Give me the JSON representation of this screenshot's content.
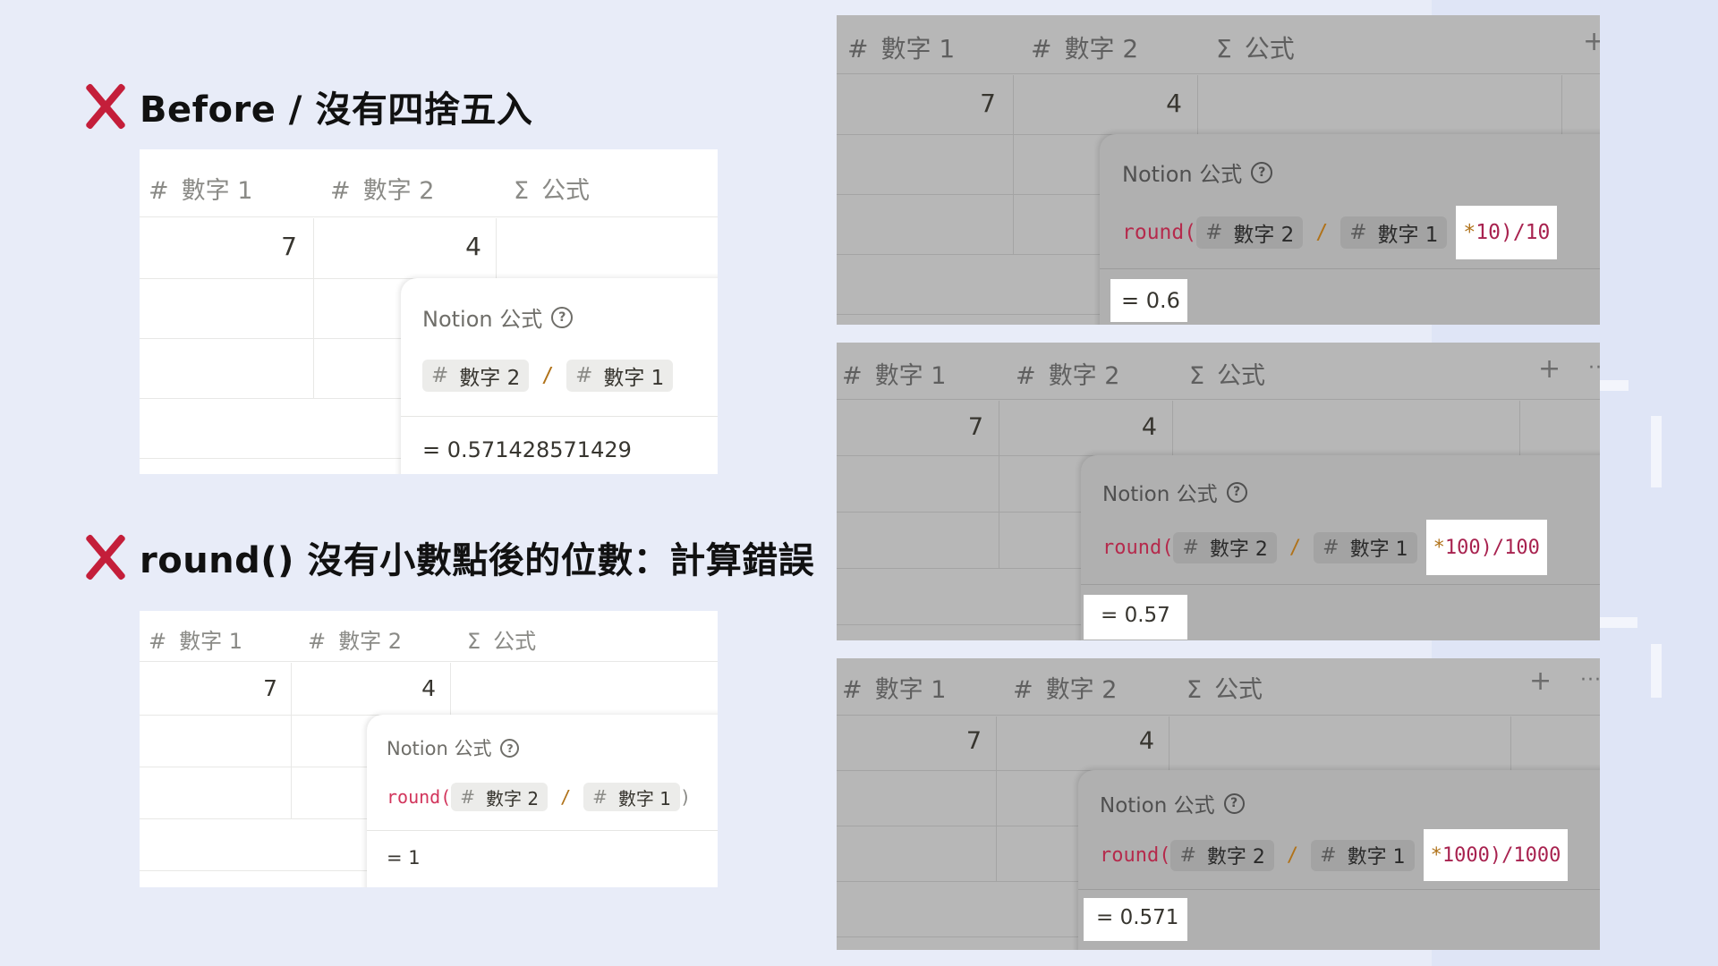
{
  "headings": {
    "before": "Before / 沒有四捨五入",
    "round_error": "round() 沒有小數點後的位數：計算錯誤"
  },
  "columns": {
    "num1": "數字 1",
    "num2": "數字 2",
    "formula": "公式",
    "num_symbol": "#",
    "formula_symbol": "Σ"
  },
  "values": {
    "a": "7",
    "b": "4"
  },
  "popup": {
    "title": "Notion 公式",
    "help": "?",
    "chip_symbol": "#",
    "chip_num2": "數字 2",
    "chip_num1": "數字 1",
    "divide": "/",
    "round_open": "round(",
    "close_paren": ")",
    "equals": "="
  },
  "panels": [
    {
      "id": "before",
      "suffix": "",
      "result": "0.571428571429"
    },
    {
      "id": "round_plain",
      "suffix": ")",
      "result": "1"
    },
    {
      "id": "x10",
      "suffix_star": "*",
      "suffix": "10)/10",
      "result": "0.6"
    },
    {
      "id": "x100",
      "suffix_star": "*",
      "suffix": "100)/100",
      "result": "0.57"
    },
    {
      "id": "x1000",
      "suffix_star": "*",
      "suffix": "1000)/1000",
      "result": "0.571"
    }
  ],
  "toolbar": {
    "add": "+",
    "more": "···"
  },
  "colors": {
    "background": "#e8ecf8",
    "cross": "#c41e3a",
    "fn": "#d2355c",
    "operator": "#b07219"
  }
}
